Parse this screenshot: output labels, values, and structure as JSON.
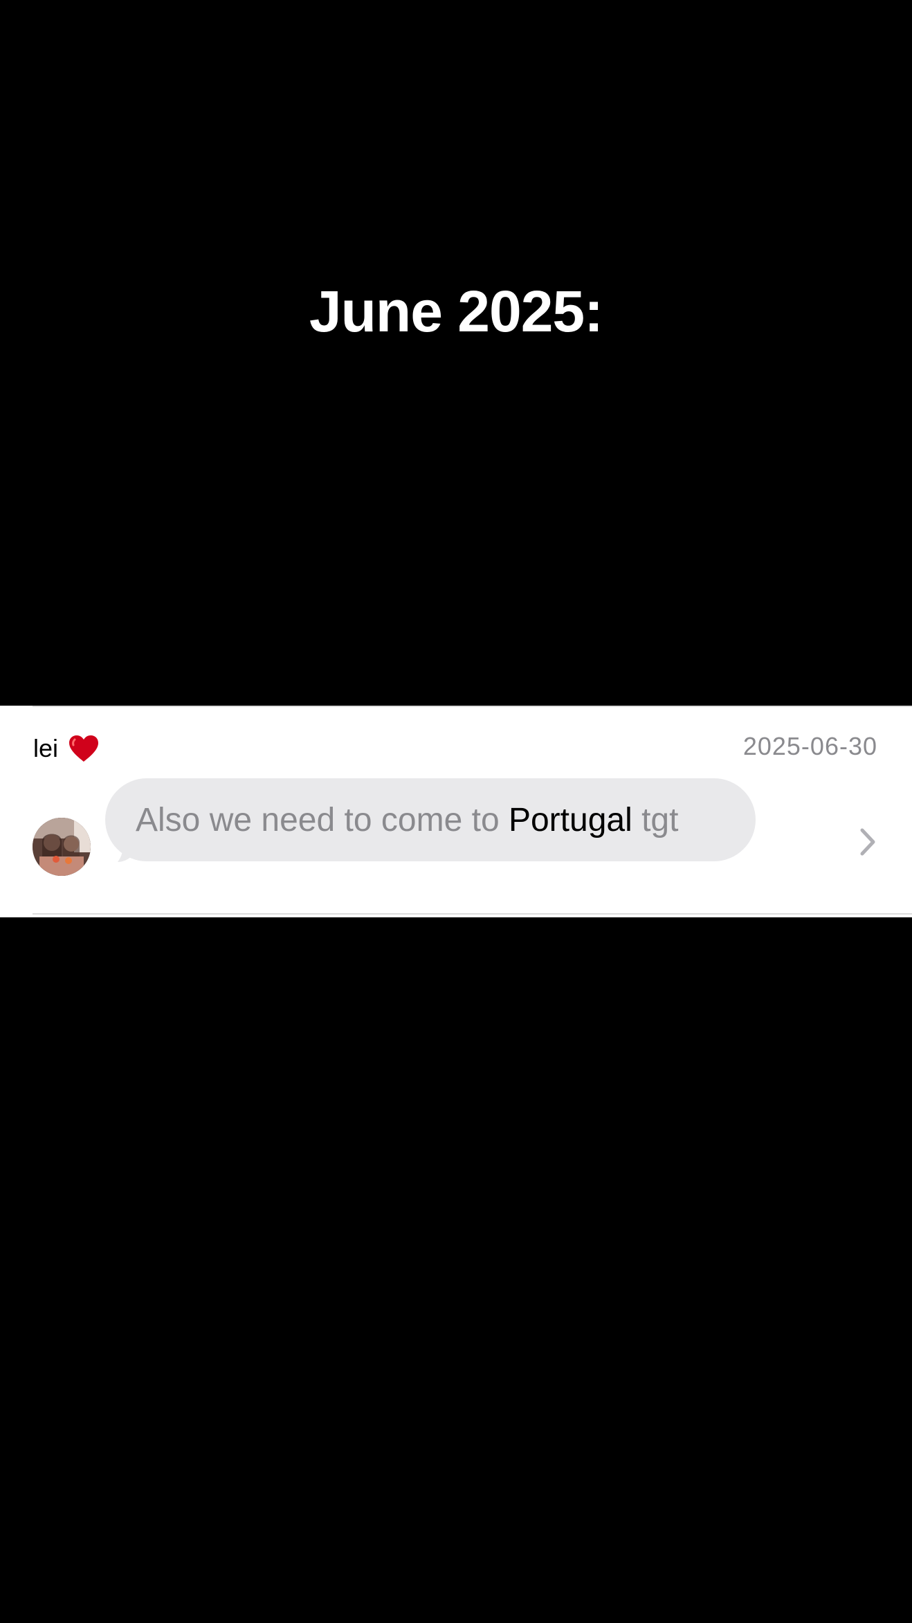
{
  "heading": "June 2025:",
  "message": {
    "sender_name": "lei",
    "sender_emoji_icon": "red-heart-icon",
    "date": "2025-06-30",
    "text_before": "Also we need to come to ",
    "text_highlight": "Portugal",
    "text_after": " tgt",
    "avatar_icon": "profile-photo",
    "chevron_icon": "chevron-right-icon"
  },
  "colors": {
    "background": "#000000",
    "card": "#ffffff",
    "bubble": "#e9e9eb",
    "muted_text": "#8a8a8e",
    "heart": "#d0021b"
  }
}
